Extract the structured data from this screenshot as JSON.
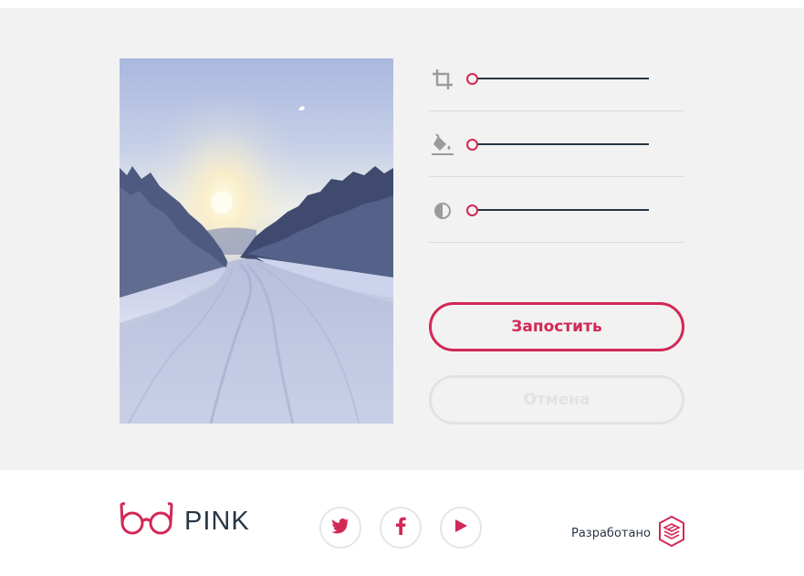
{
  "editor": {
    "controls": [
      {
        "name": "crop",
        "icon": "crop-icon",
        "value": 0
      },
      {
        "name": "fill",
        "icon": "paint-bucket-icon",
        "value": 0
      },
      {
        "name": "contrast",
        "icon": "contrast-icon",
        "value": 0
      }
    ],
    "post_label": "Запостить",
    "cancel_label": "Отмена"
  },
  "footer": {
    "logo_text": "PINK",
    "socials": [
      "twitter-icon",
      "facebook-icon",
      "youtube-icon"
    ],
    "developed_by": "Разработано"
  },
  "colors": {
    "accent": "#d22856",
    "dark": "#283645",
    "editor_bg": "#f2f2f2",
    "muted": "#e2e2e2"
  }
}
